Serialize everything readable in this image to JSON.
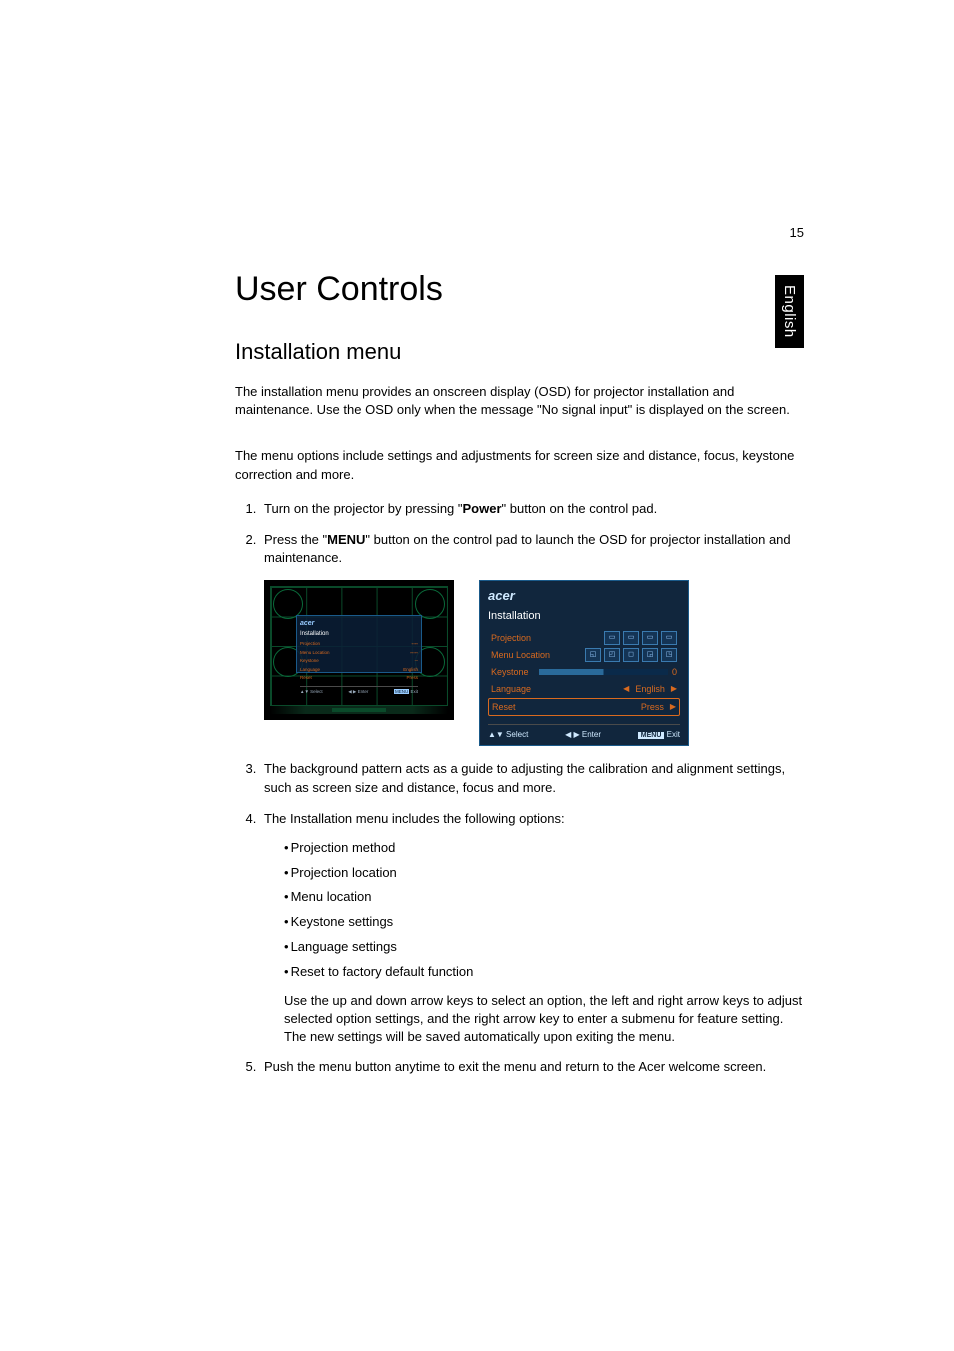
{
  "page_number": "15",
  "language_tab": "English",
  "heading1": "User Controls",
  "heading2": "Installation menu",
  "intro_p1": "The installation menu provides an onscreen display (OSD) for projector installation and maintenance. Use the OSD only when the message \"No signal input\" is displayed on the screen.",
  "intro_p2": "The menu options include settings and adjustments for screen size and distance, focus, keystone correction and more.",
  "steps": {
    "s1_pre": "Turn on the projector by pressing \"",
    "s1_bold": "Power",
    "s1_post": "\" button on the control pad.",
    "s2_pre": "Press the \"",
    "s2_bold": "MENU",
    "s2_post": "\" button on the control pad to launch the OSD for projector installation and maintenance.",
    "s3": "The background pattern acts as a guide to adjusting the calibration and alignment settings, such as screen size and distance, focus and more.",
    "s4_intro": "The Installation menu includes the following options:",
    "s4_bullets": [
      "Projection method",
      "Projection location",
      "Menu location",
      "Keystone settings",
      "Language settings",
      "Reset to factory default function"
    ],
    "s4_sub": "Use the up and down arrow keys to select an option, the left and right arrow keys to adjust selected option settings, and the right arrow key to enter a submenu for feature setting. The new settings will be saved automatically upon exiting the menu.",
    "s5": "Push the menu button anytime to exit the menu and return to the Acer welcome screen."
  },
  "osd": {
    "logo": "acer",
    "title": "Installation",
    "rows": {
      "projection": "Projection",
      "menu_location": "Menu Location",
      "keystone": "Keystone",
      "keystone_val": "0",
      "language": "Language",
      "language_val": "English",
      "reset": "Reset",
      "reset_val": "Press"
    },
    "footer": {
      "select": "▲▼ Select",
      "enter": "◀ ▶ Enter",
      "menu": "MENU",
      "exit": "Exit"
    }
  },
  "mini_osd": {
    "logo": "acer",
    "title": "Installation",
    "projection": "Projection",
    "menu_location": "Menu Location",
    "keystone": "Keystone",
    "language": "Language",
    "language_val": "English",
    "reset": "Reset",
    "reset_val": "Press",
    "select": "▲▼ Select",
    "enter": "◀ ▶ Enter",
    "menu": "MENU",
    "exit": "Exit"
  }
}
